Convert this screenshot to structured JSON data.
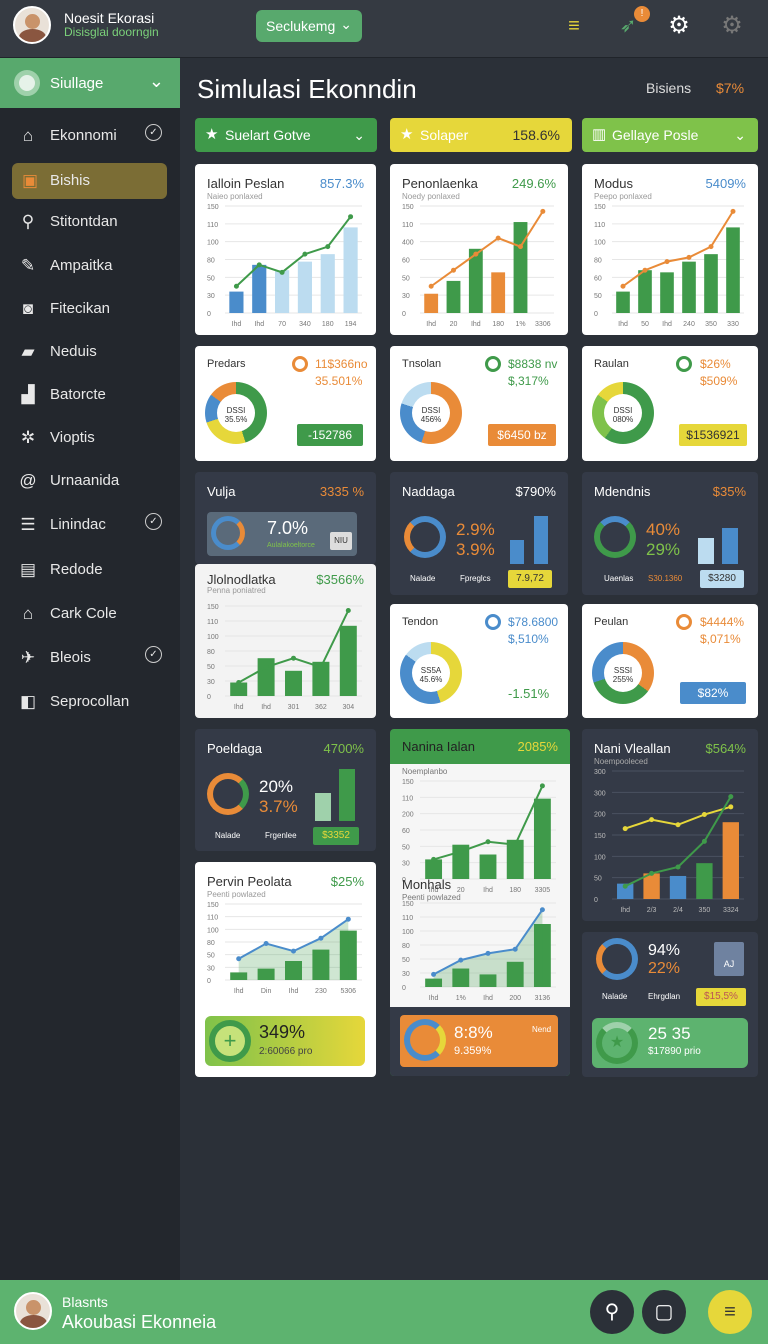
{
  "header": {
    "brand_title": "Noesit Ekorasi",
    "brand_subtitle": "Disisglai doorngin",
    "dropdown_label": "Seclukemg"
  },
  "sidebar": {
    "header_label": "Siullage",
    "items": [
      {
        "label": "Ekonnomi",
        "icon": "home-icon"
      },
      {
        "label": "Bishis",
        "icon": "chart-icon"
      },
      {
        "label": "Stitontdan",
        "icon": "search-icon"
      },
      {
        "label": "Ampaitka",
        "icon": "pen-icon"
      },
      {
        "label": "Fitecikan",
        "icon": "camera-icon"
      },
      {
        "label": "Neduis",
        "icon": "bookmark-icon"
      },
      {
        "label": "Batorcte",
        "icon": "factory-icon"
      },
      {
        "label": "Vioptis",
        "icon": "gear-icon"
      },
      {
        "label": "Urnaanida",
        "icon": "at-icon"
      },
      {
        "label": "Linindac",
        "icon": "list-icon"
      },
      {
        "label": "Redode",
        "icon": "truck-icon"
      },
      {
        "label": "Cark Cole",
        "icon": "home-icon"
      },
      {
        "label": "Bleois",
        "icon": "bird-icon"
      },
      {
        "label": "Seprocollan",
        "icon": "book-icon"
      }
    ]
  },
  "page": {
    "title": "Simlulasi Ekonndin",
    "sub_label": "Bisiens",
    "sub_value": "$7%"
  },
  "filters": [
    {
      "label": "Suelart Gotve",
      "value": ""
    },
    {
      "label": "Solaper",
      "value": "158.6%"
    },
    {
      "label": "Gellaye Posle",
      "value": ""
    }
  ],
  "cards": {
    "c1": {
      "title": "Ialloin Peslan",
      "value": "857.3%",
      "sub": "Naieo ponlaxed",
      "x": [
        "Ihd",
        "Ihd",
        "70",
        "340",
        "180",
        "194"
      ],
      "bars": [
        20,
        45,
        40,
        48,
        55,
        80
      ],
      "line": [
        25,
        45,
        38,
        55,
        62,
        90
      ],
      "ticks": [
        "150",
        "110",
        "100",
        "80",
        "50",
        "30",
        "0"
      ]
    },
    "c2": {
      "title": "Penonlaenka",
      "value": "249.6%",
      "sub": "Noedy ponlaxed",
      "x": [
        "Ihd",
        "20",
        "Ihd",
        "180",
        "1%",
        "3306"
      ],
      "bars": [
        18,
        30,
        60,
        38,
        85
      ],
      "line": [
        25,
        40,
        55,
        70,
        62,
        95
      ],
      "ticks": [
        "150",
        "110",
        "400",
        "60",
        "50",
        "30",
        "0"
      ]
    },
    "c3": {
      "title": "Modus",
      "value": "5409%",
      "sub": "Peepo ponlaxed",
      "x": [
        "Ihd",
        "50",
        "Ihd",
        "240",
        "350",
        "330"
      ],
      "bars": [
        20,
        40,
        38,
        48,
        55,
        80
      ],
      "line": [
        25,
        40,
        48,
        52,
        62,
        95
      ],
      "ticks": [
        "150",
        "110",
        "100",
        "80",
        "60",
        "50",
        "0"
      ]
    },
    "d1": {
      "title": "Predars",
      "v1": "11$366no",
      "v2": "35.501%",
      "center": "DSSI 35.5%",
      "btn": "-152786"
    },
    "d2": {
      "title": "Tnsolan",
      "v1": "$8838 nv",
      "v2": "$,317%",
      "center": "DSSI 456%",
      "btn": "$6450 bz"
    },
    "d3": {
      "title": "Raulan",
      "v1": "$26%",
      "v2": "$509%",
      "center": "DSSI 080%",
      "btn": "$1536921"
    },
    "s1": {
      "title": "Vulja",
      "value": "3335 %",
      "big": "7.0%",
      "small": "Aulalakoeltorce",
      "tag": "NIU"
    },
    "s2": {
      "title": "Naddaga",
      "value": "$790%",
      "p1": "2.9%",
      "p2": "3.9%",
      "l1": "Nalade",
      "l2": "Fpreglcs",
      "tag": "7.9,72"
    },
    "s3": {
      "title": "Mdendnis",
      "value": "$35%",
      "p1": "40%",
      "p2": "29%",
      "l1": "Uaenlas",
      "l2": "S30.1360",
      "tag": "$3280"
    },
    "c4": {
      "title": "Jlolnodlatka",
      "value": "$3566%",
      "sub": "Penna poniatred",
      "x": [
        "Ihd",
        "Ihd",
        "301",
        "362",
        "304"
      ],
      "bars": [
        15,
        42,
        28,
        38,
        78
      ],
      "line": [
        15,
        32,
        42,
        32,
        95
      ],
      "ticks": [
        "150",
        "110",
        "100",
        "80",
        "50",
        "30",
        "0"
      ]
    },
    "d4": {
      "title": "Tendon",
      "v1": "$78.6800",
      "v2": "$,510%",
      "center": "SS5A 45.6%",
      "foot": "-1.51%"
    },
    "d5": {
      "title": "Peulan",
      "v1": "$4444%",
      "v2": "$,071%",
      "center": "SSSI 255%",
      "btn": "$82%"
    },
    "s4": {
      "title": "Poeldaga",
      "value": "4700%",
      "p1": "20%",
      "p2": "3.7%",
      "l1": "Nalade",
      "l2": "Frgenlee",
      "tag": "$3352"
    },
    "c5": {
      "title": "Nanina Ialan",
      "value": "2085%",
      "sub": "Noemplanbo",
      "x": [
        "Ihd",
        "20",
        "Ihd",
        "180",
        "3305"
      ],
      "bars": [
        20,
        35,
        25,
        40,
        82
      ],
      "line": [
        20,
        28,
        38,
        35,
        95
      ],
      "ticks": [
        "150",
        "110",
        "200",
        "60",
        "50",
        "30",
        "0"
      ]
    },
    "c6": {
      "title": "Nani Vleallan",
      "value": "$564%",
      "sub": "Noempooleced",
      "x": [
        "Ihd",
        "2/3",
        "2/4",
        "350",
        "3324"
      ],
      "bars": [
        12,
        20,
        18,
        28,
        60
      ],
      "line1": [
        55,
        62,
        58,
        66,
        72
      ],
      "line2": [
        10,
        20,
        25,
        45,
        80
      ],
      "ticks": [
        "300",
        "300",
        "200",
        "150",
        "100",
        "50",
        "0"
      ]
    },
    "c7": {
      "title": "Pervin Peolata",
      "value": "$25%",
      "sub": "Peenti powlazed",
      "x": [
        "Ihd",
        "Din",
        "Ihd",
        "230",
        "5306"
      ],
      "bars": [
        10,
        15,
        25,
        40,
        65
      ],
      "line": [
        28,
        48,
        38,
        55,
        80
      ],
      "ticks": [
        "150",
        "110",
        "100",
        "80",
        "50",
        "30",
        "0"
      ]
    },
    "c8": {
      "title": "Monhals",
      "sub": "Peenti powlazed",
      "x": [
        "Ihd",
        "1%",
        "Ihd",
        "200",
        "3136"
      ],
      "bars": [
        10,
        22,
        15,
        30,
        75
      ],
      "line": [
        15,
        32,
        40,
        45,
        92
      ],
      "ticks": [
        "150",
        "110",
        "100",
        "80",
        "50",
        "30",
        "0"
      ]
    },
    "s5": {
      "title": "",
      "p1": "94%",
      "p2": "22%",
      "l1": "Nalade",
      "l2": "Ehrgdlan",
      "tag": "$15,5%",
      "tag2": "AJ"
    },
    "b1": {
      "big": "349%",
      "small": "2:60066 pro"
    },
    "b2": {
      "big": "8:8%",
      "small": "9.359%",
      "tag": "Nend"
    },
    "b3": {
      "big": "25 35",
      "small": "$17890 prio"
    }
  },
  "footer": {
    "line1": "Blasnts",
    "line2": "Akoubasi Ekonneia"
  },
  "colors": {
    "green": "#3f9a4a",
    "orange": "#e98b38",
    "blue": "#4a8ccb",
    "lightblue": "#bcdcf0",
    "yellow": "#e6d73a",
    "accent": "#5db36f"
  }
}
